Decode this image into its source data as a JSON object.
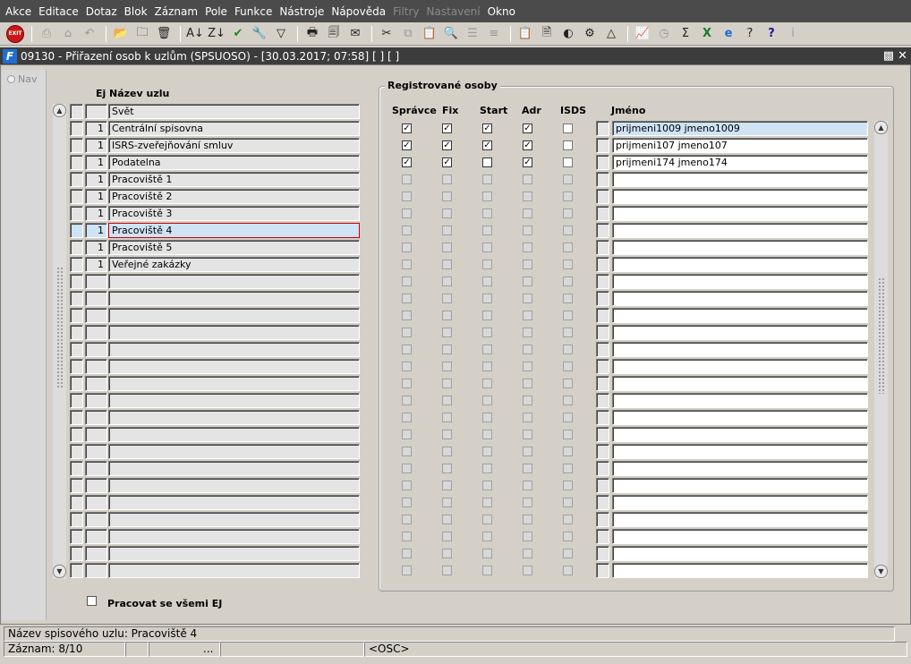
{
  "menu": [
    "Akce",
    "Editace",
    "Dotaz",
    "Blok",
    "Záznam",
    "Pole",
    "Funkce",
    "Nástroje",
    "Nápověda",
    "Filtry",
    "Nastavení",
    "Okno"
  ],
  "menu_disabled": [
    "Filtry",
    "Nastavení"
  ],
  "toolbar": {
    "exit_label": "EXIT",
    "icons": [
      "exit-icon",
      "sep",
      "print-icon",
      "home-icon",
      "undo-arrow-icon",
      "sep",
      "folder-search-icon",
      "folder-add-icon",
      "folder-delete-icon",
      "sep",
      "sort-ascending-icon",
      "sort-descending-icon",
      "check-icon",
      "wrench-icon",
      "filter-icon",
      "sep",
      "printer-icon",
      "print-preview-icon",
      "mail-icon",
      "sep",
      "cut-icon",
      "copy-icon",
      "paste-icon",
      "find-icon",
      "indent-icon",
      "outdent-icon",
      "sep",
      "clipboard-icon",
      "document-icon",
      "globe-icon",
      "settings-wheel-icon",
      "triangle-icon",
      "sep",
      "chart-icon",
      "clock-icon",
      "sum-icon",
      "excel-icon",
      "ie-icon",
      "help-question-icon",
      "context-help-icon",
      "info-icon"
    ]
  },
  "window": {
    "title": "09130 - Přiřazení osob k uzlům (SPSUOSO) - [30.03.2017; 07:58]  [ ]  [ ]",
    "nav_label": "Nav"
  },
  "nodes": {
    "header_ej": "Ej",
    "header_name": "Název uzlu",
    "rows": [
      {
        "ej": "",
        "name": "Svět"
      },
      {
        "ej": "1",
        "name": "Centrální spisovna"
      },
      {
        "ej": "1",
        "name": "ISRS-zveřejňování smluv"
      },
      {
        "ej": "1",
        "name": "Podatelna"
      },
      {
        "ej": "1",
        "name": "Pracoviště 1"
      },
      {
        "ej": "1",
        "name": "Pracoviště 2"
      },
      {
        "ej": "1",
        "name": "Pracoviště 3"
      },
      {
        "ej": "1",
        "name": "Pracoviště 4"
      },
      {
        "ej": "1",
        "name": "Pracoviště 5"
      },
      {
        "ej": "1",
        "name": "Veřejné zakázky"
      }
    ],
    "total_rows": 28,
    "selected_index": 7
  },
  "registered": {
    "frame_title": "Registrované osoby",
    "headers": {
      "spravce": "Správce",
      "fix": "Fix",
      "start": "Start",
      "adr": "Adr",
      "isds": "ISDS",
      "jmeno": "Jméno"
    },
    "rows": [
      {
        "spravce": true,
        "fix": true,
        "start": true,
        "adr": true,
        "isds": false,
        "jmeno": "prijmeni1009 jmeno1009"
      },
      {
        "spravce": true,
        "fix": true,
        "start": true,
        "adr": true,
        "isds": false,
        "jmeno": "prijmeni107 jmeno107"
      },
      {
        "spravce": true,
        "fix": true,
        "start": false,
        "adr": true,
        "isds": false,
        "jmeno": "prijmeni174 jmeno174"
      }
    ],
    "total_rows": 27
  },
  "options": {
    "all_ej_label": "Pracovat se všemi EJ",
    "all_ej_checked": false
  },
  "status": {
    "message": "Název spisového uzlu: Pracoviště 4",
    "record": "Záznam: 8/10",
    "seg2": "",
    "seg3": "...",
    "seg4": "",
    "seg5": "<OSC>"
  }
}
